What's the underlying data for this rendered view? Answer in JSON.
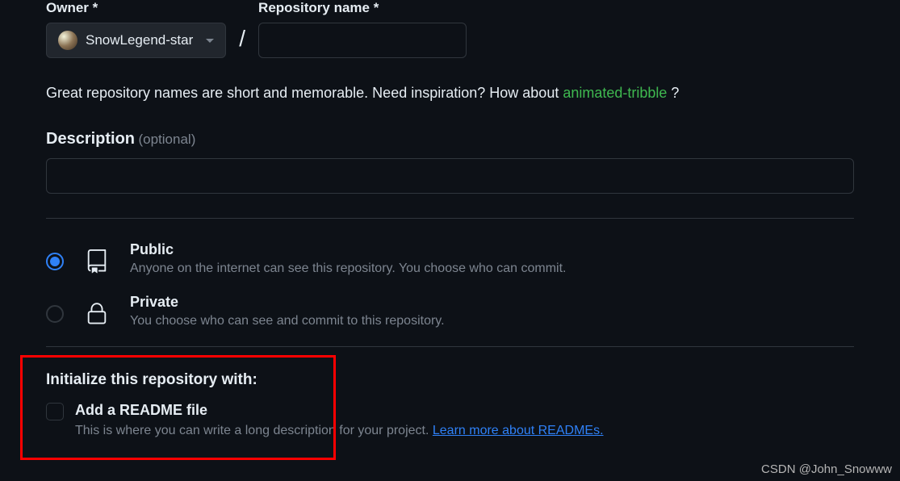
{
  "owner": {
    "label": "Owner *",
    "name": "SnowLegend-star"
  },
  "repo": {
    "label": "Repository name *",
    "value": ""
  },
  "hint": {
    "prefix": "Great repository names are short and memorable. Need inspiration? How about ",
    "suggestion": "animated-tribble",
    "suffix": " ?"
  },
  "description": {
    "label": "Description",
    "optional": "(optional)",
    "value": ""
  },
  "visibility": {
    "public": {
      "title": "Public",
      "desc": "Anyone on the internet can see this repository. You choose who can commit."
    },
    "private": {
      "title": "Private",
      "desc": "You choose who can see and commit to this repository."
    }
  },
  "init": {
    "title": "Initialize this repository with:",
    "readme": {
      "label": "Add a README file",
      "desc_prefix": "This is where you can write a long description for your project. ",
      "link": "Learn more about READMEs."
    }
  },
  "watermark": "CSDN @John_Snowww"
}
